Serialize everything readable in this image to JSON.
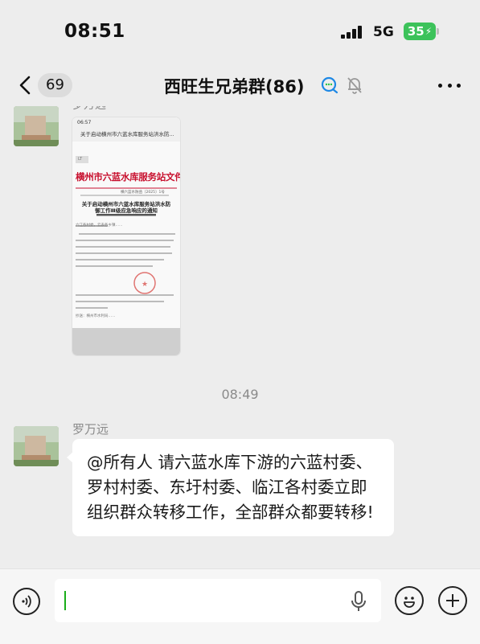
{
  "status_bar": {
    "time": "08:51",
    "network": "5G",
    "battery": "35"
  },
  "nav": {
    "unread_count": "69",
    "title": "西旺生兄弟群(86)"
  },
  "messages": {
    "top_sender_partial": "罗万远",
    "shared_doc": {
      "time": "06:57",
      "bar_text": "关于启动横州市六蓝水库服务站洪水防...",
      "tag": "LT",
      "org_header": "横州市六蓝水库服务站文件",
      "doc_number": "横六蓝水防函〔2025〕1号",
      "heading": "关于启动横州市六蓝水库服务站洪水防御工作Ⅲ级应急响应的通知",
      "body": "六江各村委，云表各乡镇……",
      "footer": "抄送：横州市水利局……"
    },
    "time_separator": "08:49",
    "sender": "罗万远",
    "text": "@所有人 请六蓝水库下游的六蓝村委、罗村村委、东圩村委、临江各村委立即组织群众转移工作，全部群众都要转移!"
  },
  "input": {
    "value": ""
  },
  "icons": {
    "back": "chevron-left-icon",
    "chat_bubble": "chat-bubble-icon",
    "mute": "bell-muted-icon",
    "more": "more-dots-icon",
    "voice": "voice-icon",
    "mic": "microphone-icon",
    "emoji": "emoji-icon",
    "plus": "plus-icon"
  },
  "colors": {
    "background": "#ededed",
    "bubble": "#ffffff",
    "battery": "#3cc25a",
    "caret": "#1aad19",
    "doc_red": "#c8102e"
  }
}
